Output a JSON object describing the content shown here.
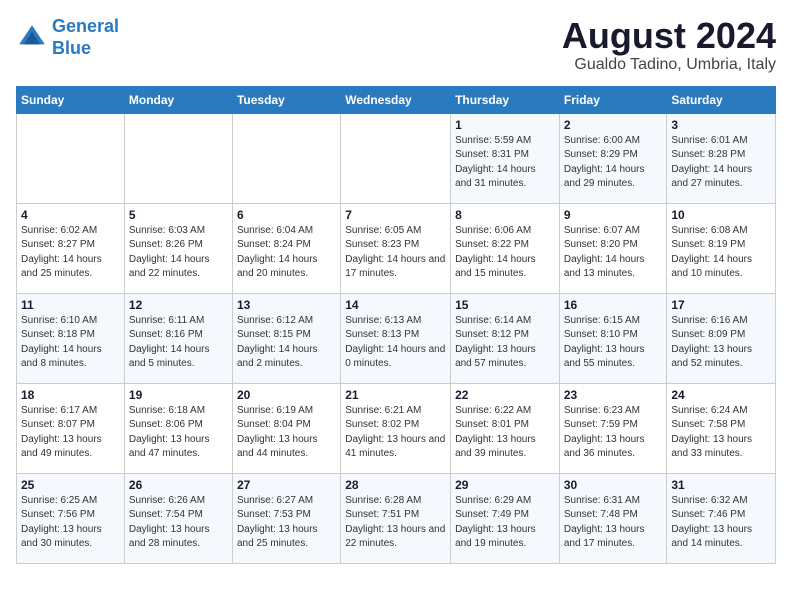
{
  "header": {
    "logo_line1": "General",
    "logo_line2": "Blue",
    "month_year": "August 2024",
    "location": "Gualdo Tadino, Umbria, Italy"
  },
  "weekdays": [
    "Sunday",
    "Monday",
    "Tuesday",
    "Wednesday",
    "Thursday",
    "Friday",
    "Saturday"
  ],
  "weeks": [
    [
      {
        "day": "",
        "info": ""
      },
      {
        "day": "",
        "info": ""
      },
      {
        "day": "",
        "info": ""
      },
      {
        "day": "",
        "info": ""
      },
      {
        "day": "1",
        "info": "Sunrise: 5:59 AM\nSunset: 8:31 PM\nDaylight: 14 hours and 31 minutes."
      },
      {
        "day": "2",
        "info": "Sunrise: 6:00 AM\nSunset: 8:29 PM\nDaylight: 14 hours and 29 minutes."
      },
      {
        "day": "3",
        "info": "Sunrise: 6:01 AM\nSunset: 8:28 PM\nDaylight: 14 hours and 27 minutes."
      }
    ],
    [
      {
        "day": "4",
        "info": "Sunrise: 6:02 AM\nSunset: 8:27 PM\nDaylight: 14 hours and 25 minutes."
      },
      {
        "day": "5",
        "info": "Sunrise: 6:03 AM\nSunset: 8:26 PM\nDaylight: 14 hours and 22 minutes."
      },
      {
        "day": "6",
        "info": "Sunrise: 6:04 AM\nSunset: 8:24 PM\nDaylight: 14 hours and 20 minutes."
      },
      {
        "day": "7",
        "info": "Sunrise: 6:05 AM\nSunset: 8:23 PM\nDaylight: 14 hours and 17 minutes."
      },
      {
        "day": "8",
        "info": "Sunrise: 6:06 AM\nSunset: 8:22 PM\nDaylight: 14 hours and 15 minutes."
      },
      {
        "day": "9",
        "info": "Sunrise: 6:07 AM\nSunset: 8:20 PM\nDaylight: 14 hours and 13 minutes."
      },
      {
        "day": "10",
        "info": "Sunrise: 6:08 AM\nSunset: 8:19 PM\nDaylight: 14 hours and 10 minutes."
      }
    ],
    [
      {
        "day": "11",
        "info": "Sunrise: 6:10 AM\nSunset: 8:18 PM\nDaylight: 14 hours and 8 minutes."
      },
      {
        "day": "12",
        "info": "Sunrise: 6:11 AM\nSunset: 8:16 PM\nDaylight: 14 hours and 5 minutes."
      },
      {
        "day": "13",
        "info": "Sunrise: 6:12 AM\nSunset: 8:15 PM\nDaylight: 14 hours and 2 minutes."
      },
      {
        "day": "14",
        "info": "Sunrise: 6:13 AM\nSunset: 8:13 PM\nDaylight: 14 hours and 0 minutes."
      },
      {
        "day": "15",
        "info": "Sunrise: 6:14 AM\nSunset: 8:12 PM\nDaylight: 13 hours and 57 minutes."
      },
      {
        "day": "16",
        "info": "Sunrise: 6:15 AM\nSunset: 8:10 PM\nDaylight: 13 hours and 55 minutes."
      },
      {
        "day": "17",
        "info": "Sunrise: 6:16 AM\nSunset: 8:09 PM\nDaylight: 13 hours and 52 minutes."
      }
    ],
    [
      {
        "day": "18",
        "info": "Sunrise: 6:17 AM\nSunset: 8:07 PM\nDaylight: 13 hours and 49 minutes."
      },
      {
        "day": "19",
        "info": "Sunrise: 6:18 AM\nSunset: 8:06 PM\nDaylight: 13 hours and 47 minutes."
      },
      {
        "day": "20",
        "info": "Sunrise: 6:19 AM\nSunset: 8:04 PM\nDaylight: 13 hours and 44 minutes."
      },
      {
        "day": "21",
        "info": "Sunrise: 6:21 AM\nSunset: 8:02 PM\nDaylight: 13 hours and 41 minutes."
      },
      {
        "day": "22",
        "info": "Sunrise: 6:22 AM\nSunset: 8:01 PM\nDaylight: 13 hours and 39 minutes."
      },
      {
        "day": "23",
        "info": "Sunrise: 6:23 AM\nSunset: 7:59 PM\nDaylight: 13 hours and 36 minutes."
      },
      {
        "day": "24",
        "info": "Sunrise: 6:24 AM\nSunset: 7:58 PM\nDaylight: 13 hours and 33 minutes."
      }
    ],
    [
      {
        "day": "25",
        "info": "Sunrise: 6:25 AM\nSunset: 7:56 PM\nDaylight: 13 hours and 30 minutes."
      },
      {
        "day": "26",
        "info": "Sunrise: 6:26 AM\nSunset: 7:54 PM\nDaylight: 13 hours and 28 minutes."
      },
      {
        "day": "27",
        "info": "Sunrise: 6:27 AM\nSunset: 7:53 PM\nDaylight: 13 hours and 25 minutes."
      },
      {
        "day": "28",
        "info": "Sunrise: 6:28 AM\nSunset: 7:51 PM\nDaylight: 13 hours and 22 minutes."
      },
      {
        "day": "29",
        "info": "Sunrise: 6:29 AM\nSunset: 7:49 PM\nDaylight: 13 hours and 19 minutes."
      },
      {
        "day": "30",
        "info": "Sunrise: 6:31 AM\nSunset: 7:48 PM\nDaylight: 13 hours and 17 minutes."
      },
      {
        "day": "31",
        "info": "Sunrise: 6:32 AM\nSunset: 7:46 PM\nDaylight: 13 hours and 14 minutes."
      }
    ]
  ]
}
